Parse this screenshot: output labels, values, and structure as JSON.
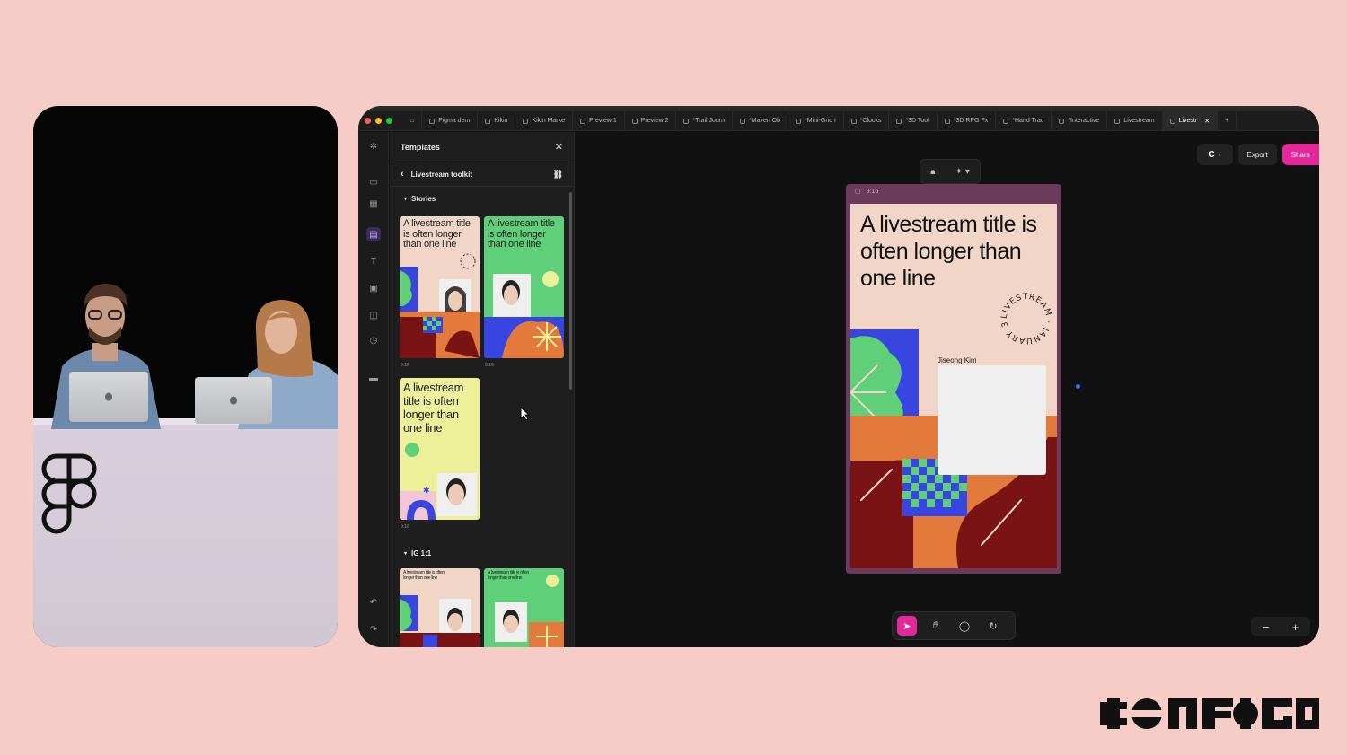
{
  "app": {
    "tabs": [
      {
        "label": "Figma dem",
        "icon": "file-icon"
      },
      {
        "label": "Kikin",
        "icon": "file-icon"
      },
      {
        "label": "Kikin Marke",
        "icon": "file-icon"
      },
      {
        "label": "Preview 1",
        "icon": "file-icon"
      },
      {
        "label": "Preview 2",
        "icon": "file-icon"
      },
      {
        "label": "*Trail Journ",
        "icon": "file-icon"
      },
      {
        "label": "*Maven Ob",
        "icon": "file-icon"
      },
      {
        "label": "*Mini-Grid i",
        "icon": "file-icon"
      },
      {
        "label": "*Clocks",
        "icon": "file-icon"
      },
      {
        "label": "*3D Tool",
        "icon": "file-icon"
      },
      {
        "label": "*3D RPG Fx",
        "icon": "file-icon"
      },
      {
        "label": "*Hand Trac",
        "icon": "file-icon"
      },
      {
        "label": "*Interactive",
        "icon": "file-icon"
      },
      {
        "label": "Livestream",
        "icon": "file-icon"
      },
      {
        "label": "Livestr",
        "icon": "file-icon",
        "active": true
      }
    ],
    "new_tab_symbol": "+",
    "tab_close_symbol": "✕"
  },
  "panel": {
    "title": "Templates",
    "close_symbol": "✕",
    "back_symbol": "‹",
    "breadcrumb": "Livestream toolkit",
    "section_stories": "Stories",
    "section_ig": "IG 1:1",
    "thumb_title": "A livestream title is often longer than one line",
    "thumb_label": "9:16"
  },
  "toolbar": {
    "export_label": "Export",
    "share_label": "Share",
    "user_initial": "C"
  },
  "frame": {
    "label": "9:16",
    "title": "A livestream title is often longer than one line",
    "stamp_text": "LIVESTREAM · JANUARY 31 ·",
    "name": "Jiseong Kim"
  },
  "zoom": {
    "minus": "−",
    "plus": "+"
  },
  "colors": {
    "background": "#f6cdc6",
    "accent_pink": "#e4279a",
    "story_bg": "#f1d6c8",
    "green": "#5fcf7a",
    "blue": "#3845e0",
    "orange": "#e37a3c",
    "maroon": "#7a1414",
    "yellow": "#ecf199"
  },
  "branding": {
    "config_logo": "config-wordmark",
    "figma_logo": "figma-logo"
  }
}
